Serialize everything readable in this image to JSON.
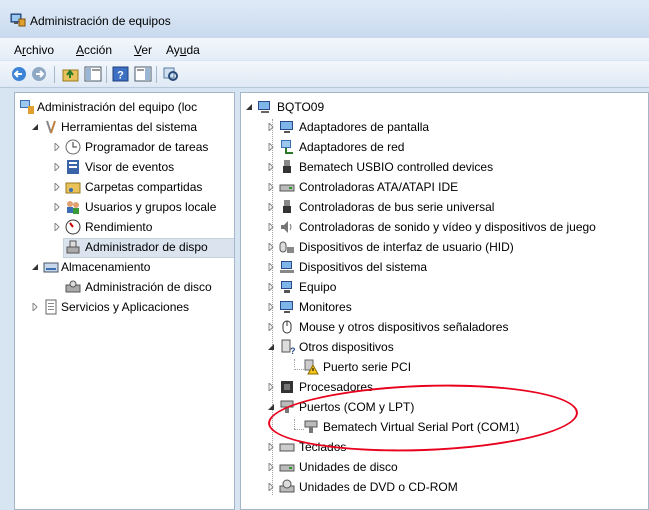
{
  "window": {
    "title": "Administración de equipos"
  },
  "menu": [
    {
      "label": "Archivo"
    },
    {
      "label": "Acción"
    },
    {
      "label": "Ver"
    },
    {
      "label": "Ayuda"
    }
  ],
  "toolbar": [
    "back-icon",
    "forward-icon",
    "up-folder-icon",
    "show-hide-tree-icon",
    "help-icon",
    "show-hide-action-pane-icon",
    "properties-icon"
  ],
  "left_tree": [
    {
      "label": "Administración del equipo (loc",
      "icon": "computer-management-icon"
    },
    {
      "label": "Herramientas del sistema",
      "icon": "system-tools-icon"
    },
    {
      "label": "Programador de tareas",
      "icon": "clock-icon"
    },
    {
      "label": "Visor de eventos",
      "icon": "event-viewer-icon"
    },
    {
      "label": "Carpetas compartidas",
      "icon": "shared-folder-icon"
    },
    {
      "label": "Usuarios y grupos locale",
      "icon": "users-icon"
    },
    {
      "label": "Rendimiento",
      "icon": "performance-icon"
    },
    {
      "label": "Administrador de dispo",
      "icon": "device-manager-icon"
    },
    {
      "label": "Almacenamiento",
      "icon": "storage-icon"
    },
    {
      "label": "Administración de disco",
      "icon": "disk-management-icon"
    },
    {
      "label": "Servicios y Aplicaciones",
      "icon": "services-icon"
    }
  ],
  "right_tree": {
    "root": "BQTO09",
    "items": [
      {
        "label": "Adaptadores de pantalla",
        "icon": "display-adapter-icon"
      },
      {
        "label": "Adaptadores de red",
        "icon": "network-adapter-icon"
      },
      {
        "label": "Bematech USBIO controlled devices",
        "icon": "usb-device-icon"
      },
      {
        "label": "Controladoras ATA/ATAPI IDE",
        "icon": "ide-controller-icon"
      },
      {
        "label": "Controladoras de bus serie universal",
        "icon": "usb-controller-icon"
      },
      {
        "label": "Controladoras de sonido y vídeo y dispositivos de juego",
        "icon": "sound-icon"
      },
      {
        "label": "Dispositivos de interfaz de usuario (HID)",
        "icon": "hid-icon"
      },
      {
        "label": "Dispositivos del sistema",
        "icon": "system-devices-icon"
      },
      {
        "label": "Equipo",
        "icon": "computer-icon"
      },
      {
        "label": "Monitores",
        "icon": "monitor-icon"
      },
      {
        "label": "Mouse y otros dispositivos señaladores",
        "icon": "mouse-icon"
      },
      {
        "label": "Otros dispositivos",
        "icon": "other-devices-icon"
      },
      {
        "label": "Puerto serie PCI",
        "icon": "warning-device-icon"
      },
      {
        "label": "Procesadores",
        "icon": "processor-icon"
      },
      {
        "label": "Puertos (COM y LPT)",
        "icon": "port-icon"
      },
      {
        "label": "Bematech Virtual Serial Port (COM1)",
        "icon": "serial-port-icon"
      },
      {
        "label": "Teclados",
        "icon": "keyboard-icon"
      },
      {
        "label": "Unidades de disco",
        "icon": "disk-drive-icon"
      },
      {
        "label": "Unidades de DVD o CD-ROM",
        "icon": "dvd-icon"
      }
    ]
  },
  "annotation_color": "#e8001c"
}
